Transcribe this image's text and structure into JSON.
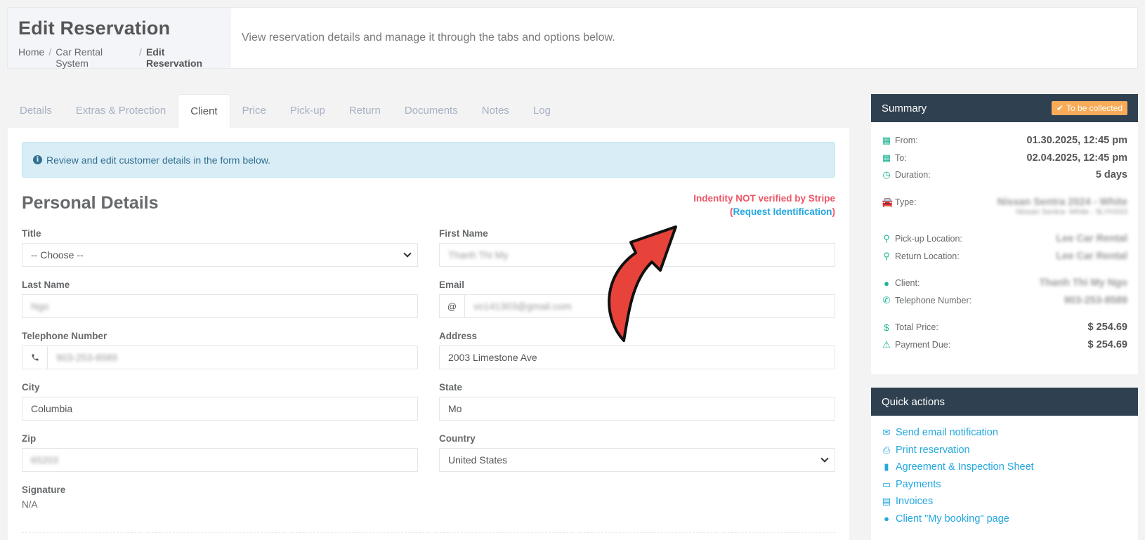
{
  "header": {
    "title": "Edit Reservation",
    "breadcrumb": [
      "Home",
      "Car Rental System",
      "Edit Reservation"
    ],
    "description": "View reservation details and manage it through the tabs and options below."
  },
  "tabs": [
    "Details",
    "Extras & Protection",
    "Client",
    "Price",
    "Pick-up",
    "Return",
    "Documents",
    "Notes",
    "Log"
  ],
  "active_tab": "Client",
  "alert": {
    "text": "Review and edit customer details in the form below.",
    "icon": "info-icon"
  },
  "section": {
    "title": "Personal Details",
    "verify_text": "Indentity NOT verified by Stripe",
    "verify_open": "(",
    "verify_link": "Request Identification",
    "verify_close": ")"
  },
  "form": {
    "title_label": "Title",
    "title_value": "-- Choose --",
    "first_name_label": "First Name",
    "first_name_value": "Thanh Thi My",
    "last_name_label": "Last Name",
    "last_name_value": "Ngo",
    "email_label": "Email",
    "email_addon": "@",
    "email_value": "vo141303@gmail.com",
    "phone_label": "Telephone Number",
    "phone_value": "903-253-8589",
    "address_label": "Address",
    "address_value": "2003 Limestone Ave",
    "city_label": "City",
    "city_value": "Columbia",
    "state_label": "State",
    "state_value": "Mo",
    "zip_label": "Zip",
    "zip_value": "65203",
    "country_label": "Country",
    "country_value": "United States",
    "signature_label": "Signature",
    "signature_value": "N/A"
  },
  "summary": {
    "title": "Summary",
    "badge": "To be collected",
    "badge_color": "#f8ac59",
    "from_label": "From:",
    "from_value": "01.30.2025, 12:45 pm",
    "to_label": "To:",
    "to_value": "02.04.2025, 12:45 pm",
    "duration_label": "Duration:",
    "duration_value": "5 days",
    "type_label": "Type:",
    "type_value": "Nissan Sentra 2024 - White",
    "type_sub": "Nissan Sentra- White - 9LYH333",
    "pickup_label": "Pick-up Location:",
    "pickup_value": "Lee Car Rental",
    "return_label": "Return Location:",
    "return_value": "Lee Car Rental",
    "client_label": "Client:",
    "client_value": "Thanh Thi My Ngo",
    "phone_label": "Telephone Number:",
    "phone_value": "903-253-8589",
    "total_label": "Total Price:",
    "total_value": "$ 254.69",
    "due_label": "Payment Due:",
    "due_value": "$ 254.69"
  },
  "quick_actions": {
    "title": "Quick actions",
    "items": [
      {
        "label": "Send email notification",
        "icon": "envelope-icon"
      },
      {
        "label": "Print reservation",
        "icon": "print-icon"
      },
      {
        "label": "Agreement & Inspection Sheet",
        "icon": "file-icon"
      },
      {
        "label": "Payments",
        "icon": "credit-card-icon"
      },
      {
        "label": "Invoices",
        "icon": "file-text-icon"
      },
      {
        "label": "Client \"My booking\" page",
        "icon": "user-icon"
      }
    ]
  },
  "colors": {
    "accent": "#1ab394",
    "link": "#23a7e0",
    "danger": "#ed5565",
    "dark": "#2f4050"
  }
}
